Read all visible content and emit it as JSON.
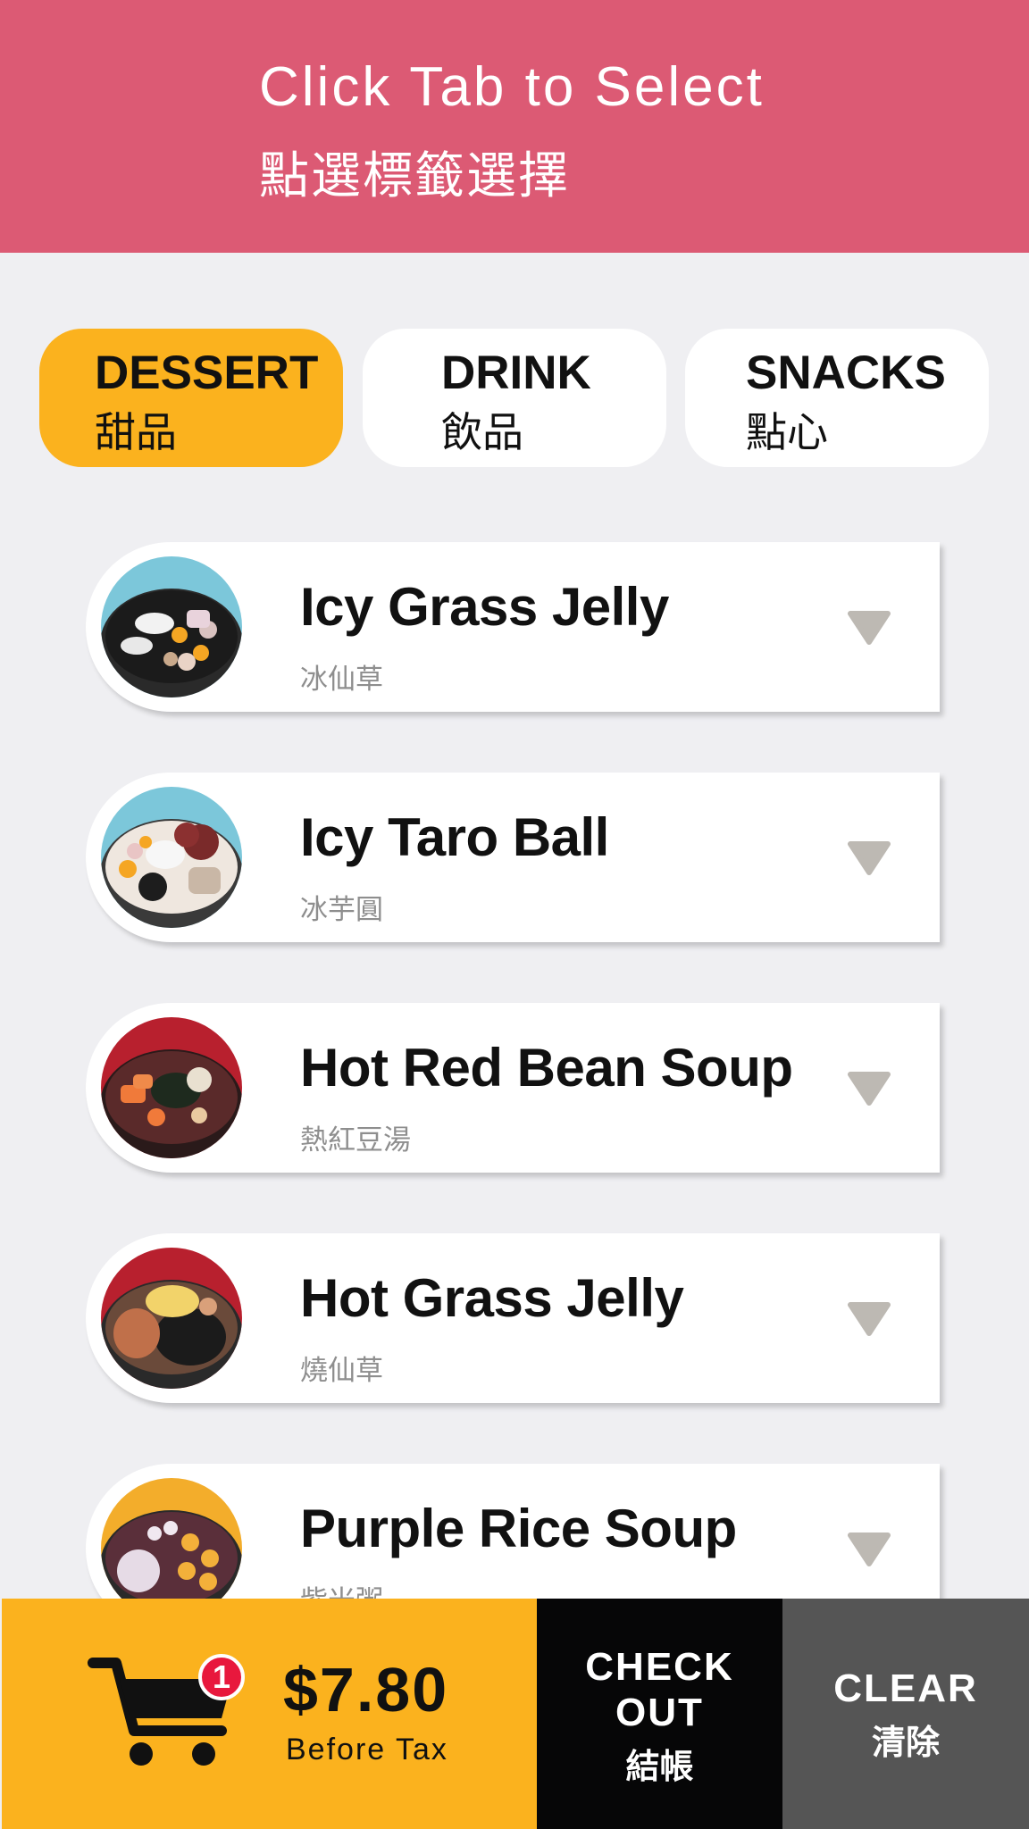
{
  "header": {
    "title_en": "Click Tab to Select",
    "title_zh": "點選標籤選擇",
    "color": "#dc5a74"
  },
  "tabs": [
    {
      "en": "DESSERT",
      "zh": "甜品",
      "active": true
    },
    {
      "en": "DRINK",
      "zh": "飲品",
      "active": false
    },
    {
      "en": "SNACKS",
      "zh": "點心",
      "active": false
    }
  ],
  "items": [
    {
      "name": "Icy Grass Jelly",
      "zh": "冰仙草",
      "icon": "chevron-down-icon"
    },
    {
      "name": "Icy Taro Ball",
      "zh": "冰芋圓",
      "icon": "chevron-down-icon"
    },
    {
      "name": "Hot Red Bean Soup",
      "zh": "熱紅豆湯",
      "icon": "chevron-down-icon"
    },
    {
      "name": "Hot Grass Jelly",
      "zh": "燒仙草",
      "icon": "chevron-down-icon"
    },
    {
      "name": "Purple Rice Soup",
      "zh": "紫米粥",
      "icon": "chevron-down-icon"
    }
  ],
  "cart": {
    "count": "1",
    "price": "$7.80",
    "note": "Before Tax",
    "icon": "cart-icon"
  },
  "checkout": {
    "line1": "CHECK",
    "line2": "OUT",
    "zh": "結帳"
  },
  "clear": {
    "en": "CLEAR",
    "zh": "清除"
  },
  "colors": {
    "accent": "#fbb21e",
    "checkout_bg": "#060607",
    "clear_bg": "#555555",
    "background": "#efeff2"
  }
}
